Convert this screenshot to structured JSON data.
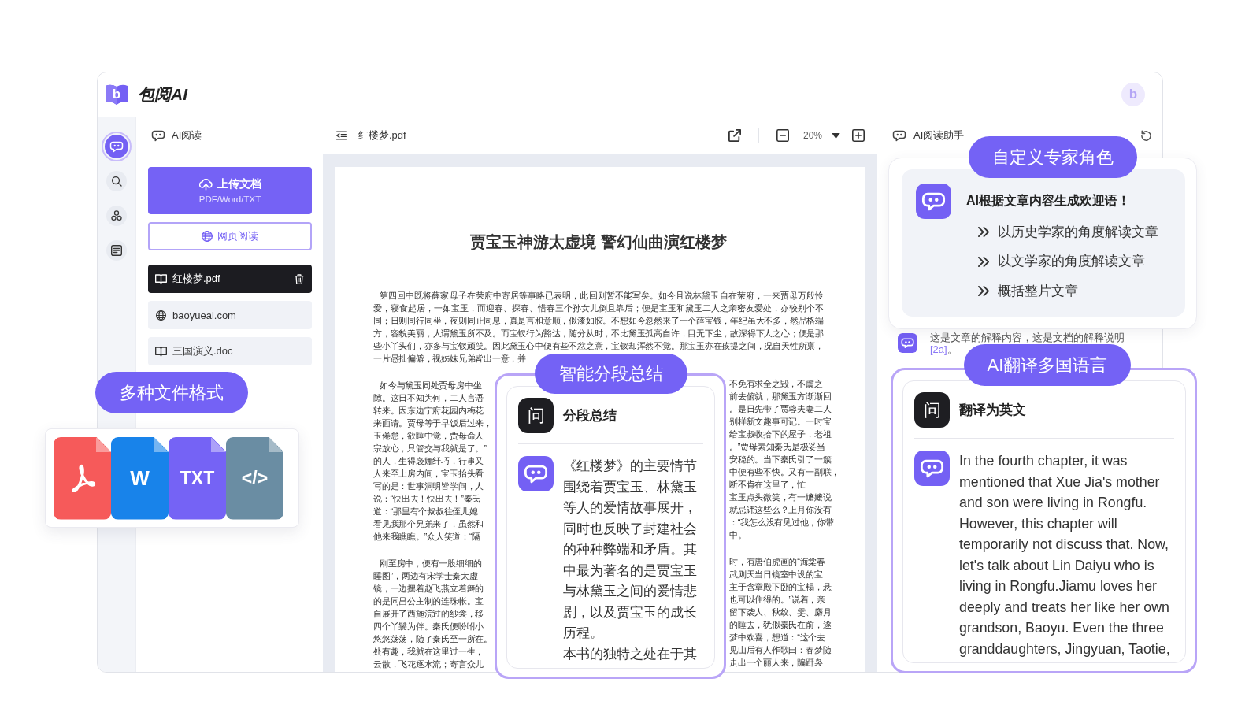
{
  "header": {
    "logo_letter": "b",
    "app_name": "包阅AI",
    "avatar_letter": "b"
  },
  "rail": [
    {
      "kind": "chat",
      "selected": true
    },
    {
      "kind": "search",
      "selected": false
    },
    {
      "kind": "apps",
      "selected": false
    },
    {
      "kind": "notes",
      "selected": false
    }
  ],
  "reader_panel": {
    "title": "AI阅读",
    "upload": {
      "label": "上传文档",
      "formats": "PDF/Word/TXT"
    },
    "web_reading": "网页阅读",
    "files": [
      {
        "kind": "document",
        "name": "红楼梦.pdf",
        "selected": true
      },
      {
        "kind": "web",
        "name": "baoyueai.com",
        "selected": false
      },
      {
        "kind": "document",
        "name": "三国演义.doc",
        "selected": false
      }
    ]
  },
  "viewer": {
    "file_name": "红楼梦.pdf",
    "zoom": "20%",
    "page": {
      "title": "贾宝玉神游太虚境 警幻仙曲演红楼梦",
      "paragraphs": [
        {
          "lines": [
            {
              "text": "第四回中既将薛家母子在荣府中寄居等事略已表明，此回则暂不能写矣。如今且说林黛玉自在荣府，一来贾母万般怜"
            },
            {
              "text": "爱，寝食起居，一如宝玉，而迎春、探春、惜春三个孙女儿倒且靠后；便是宝玉和黛玉二人之亲密友爱处，亦较别个不"
            },
            {
              "text": "同；日则同行同坐，夜则同止同息，真是言和意顺，似漆如胶。不想如今忽然来了一个薛宝钗，年纪虽大不多，然品格端"
            },
            {
              "text": "方，容貌美丽，人谓黛玉所不及。而宝钗行为豁达，随分从时，不比黛玉孤高自许，目无下尘，故深得下人之心；便是那"
            },
            {
              "text": "些小丫头们，亦多与宝钗顽笑。因此黛玉心中便有些不忿之意，宝钗却浑然不觉。那宝玉亦在孩提之间，况自天性所禀，"
            },
            {
              "text": "一片愚拙偏僻，视姊妹兄弟皆出一意，并"
            }
          ]
        },
        {
          "lines": [
            {
              "left": "如今与黛玉同处贾母房中坐",
              "right": "不免有求全之毁，不虞之"
            },
            {
              "left": "隙。这日不知为何，二人言语",
              "right": "前去俯就，那黛玉方渐渐回"
            },
            {
              "left": "转来。因东边宁府花园内梅花",
              "right": "。是日先带了贾蓉夫妻二人"
            },
            {
              "left": "来面请。贾母等于早饭后过来，",
              "right": "别样新文趣事可记。一时宝"
            },
            {
              "left": "玉倦怠，欲睡中觉，贾母命人",
              "right": "给宝叔收拾下的屋子，老祖"
            },
            {
              "left": "宗放心，只管交与我就是了。”",
              "right": "。”贾母素知秦氏是极妥当"
            },
            {
              "left": "的人，生得袅娜纤巧，行事又",
              "right": "安稳的。当下秦氏引了一簇"
            },
            {
              "left": "人来至上房内间，宝玉抬头看",
              "right": "中便有些不快。又有一副联，"
            },
            {
              "left": "写的是：世事洞明皆学问，人",
              "right": "断不肯在这里了，忙"
            },
            {
              "left": "说：“快出去！快出去！”秦氏",
              "right": "宝玉点头微笑，有一嬷嬷说"
            },
            {
              "left": "道：“那里有个叔叔往侄儿媳",
              "right": "就忌讳这些么？上月你没有"
            },
            {
              "left": "看见我那个兄弟来了，虽然和",
              "right": "：“我怎么没有见过他，你带"
            },
            {
              "left": "他来我瞧瞧。”众人笑道：“隔",
              "right": "中。"
            }
          ]
        },
        {
          "lines": [
            {
              "left": "刚至房中，便有一股细细的",
              "right": "时，有唐伯虎画的“海棠春"
            },
            {
              "left": "睡图”，两边有宋学士秦太虚",
              "right": "武则天当日镜室中设的宝"
            },
            {
              "left": "镜，一边摆着赵飞燕立着舞的",
              "right": "主于含章殿下卧的宝榻，悬"
            },
            {
              "left": "的是同昌公主制的连珠帐。宝",
              "right": "也可以住得的。”说着，亲"
            },
            {
              "left": "自展开了西施浣过的纱衾，移",
              "right": "留下袭人、秋纹、雯、麝月"
            },
            {
              "left": "四个丫鬟为伴。秦氏便吩咐小",
              "right": "的睡去，犹似秦氏在前，遂"
            },
            {
              "left": "悠悠荡荡，随了秦氏至一所在。",
              "right": "梦中欢喜，想道：“这个去"
            },
            {
              "left": "处有趣，我就在这里过一生，",
              "right": "见山后有人作歌曰：春梦随"
            },
            {
              "left": "云散，飞花逐水流；寄言众儿",
              "right": "走出一个丽人来，蹁跹袅"
            }
          ]
        }
      ]
    }
  },
  "assistant": {
    "title": "AI阅读助手",
    "message": {
      "text": "这是文章的解释内容，这是文档的解释说明",
      "citation": "[2a]",
      "end": "。"
    }
  },
  "format_callout": {
    "label": "多种文件格式",
    "formats": [
      {
        "kind": "pdf",
        "color": "#f65a5a"
      },
      {
        "kind": "word",
        "label": "W",
        "color": "#1883ea"
      },
      {
        "kind": "txt",
        "label": "TXT",
        "color": "#7563f5"
      },
      {
        "kind": "code",
        "label": "</>",
        "color": "#6a8da3"
      }
    ]
  },
  "summary_callout": {
    "label": "智能分段总结",
    "question_mark": "问",
    "prompt": "分段总结",
    "answer": [
      "《红楼梦》的主要情节围绕着贾宝玉、林黛玉等人的爱情故事展开，同时也反映了封建社会的种种弊端和矛盾。其中最为著名的是贾宝玉与林黛玉之间的爱情悲剧，以及贾宝玉的成长历程。",
      "本书的独特之处在于其"
    ]
  },
  "expert_callout": {
    "label": "自定义专家角色",
    "greeting": "AI根据文章内容生成欢迎语！",
    "suggestions": [
      "以历史学家的角度解读文章",
      "以文学家的角度解读文章",
      "概括整片文章"
    ]
  },
  "translate_callout": {
    "label": "AI翻译多国语言",
    "question_mark": "问",
    "prompt": "翻译为英文",
    "answer": "In the fourth chapter, it was mentioned that Xue Jia's mother and son were living in Rongfu. However, this chapter will temporarily not discuss that. Now, let's talk about Lin Daiyu who is living in Rongfu.Jiamu loves her deeply and treats her like her own grandson, Baoyu. Even the three granddaughters, Jingyuan, Taotie,"
  }
}
